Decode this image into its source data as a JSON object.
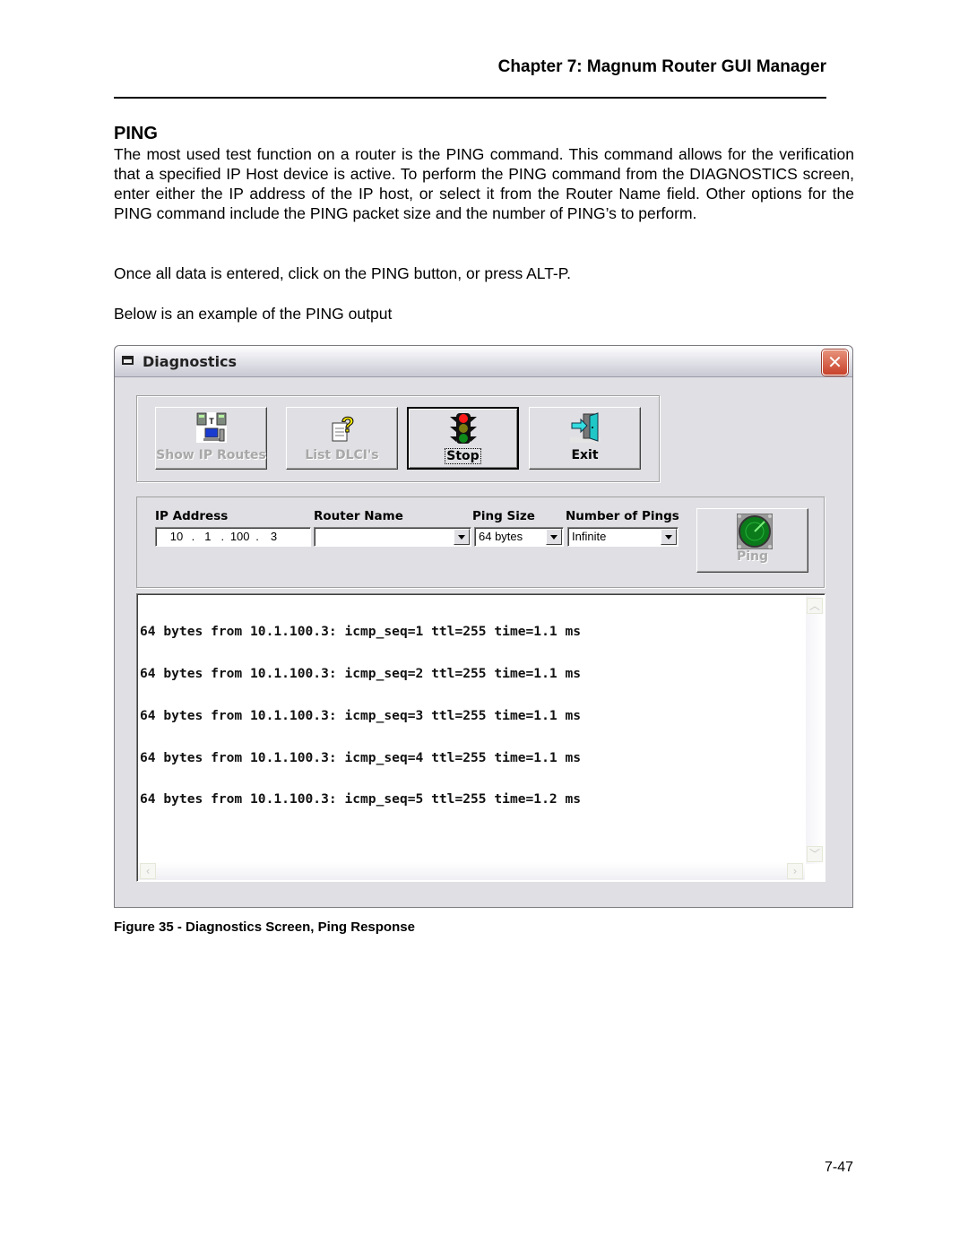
{
  "header": {
    "chapter_title": "Chapter 7: Magnum Router GUI Manager"
  },
  "section": {
    "title": "PING",
    "paragraphs": [
      "The most used test function on a router is the PING command.  This command allows for the verification that a specified IP Host device is active.  To perform the PING command from the DIAGNOSTICS screen, enter either the IP address of the IP host, or select it from the Router Name field.  Other options for the PING command include the PING packet size and the number of PING’s to perform.",
      "Once all data is entered, click on the PING button, or press ALT-P.",
      "Below is an example of the PING output"
    ]
  },
  "window": {
    "title": "Diagnostics",
    "close_glyph": "✕",
    "toolbar": [
      {
        "id": "show-ip-routes",
        "label": "Show IP Routes",
        "icon": "network-computers-icon",
        "enabled": false
      },
      {
        "id": "list-dlcis",
        "label": "List DLCI's",
        "icon": "document-question-icon",
        "enabled": false
      },
      {
        "id": "stop",
        "label": "Stop",
        "icon": "traffic-light-icon",
        "enabled": true,
        "default": true
      },
      {
        "id": "exit",
        "label": "Exit",
        "icon": "exit-door-icon",
        "enabled": true
      }
    ],
    "fields": {
      "ip_address": {
        "label": "IP Address",
        "octets": [
          "10",
          "1",
          "100",
          "3"
        ]
      },
      "router_name": {
        "label": "Router Name",
        "value": ""
      },
      "ping_size": {
        "label": "Ping Size",
        "value": "64 bytes"
      },
      "number_of_pings": {
        "label": "Number of Pings",
        "value": "Infinite"
      }
    },
    "ping_button": {
      "label": "Ping",
      "icon": "radar-icon",
      "enabled": false
    },
    "output_lines": [
      "64 bytes from 10.1.100.3: icmp_seq=1 ttl=255 time=1.1 ms",
      "64 bytes from 10.1.100.3: icmp_seq=2 ttl=255 time=1.1 ms",
      "64 bytes from 10.1.100.3: icmp_seq=3 ttl=255 time=1.1 ms",
      "64 bytes from 10.1.100.3: icmp_seq=4 ttl=255 time=1.1 ms",
      "64 bytes from 10.1.100.3: icmp_seq=5 ttl=255 time=1.2 ms"
    ]
  },
  "figure_caption": "Figure 35 - Diagnostics Screen, Ping Response",
  "page_number": "7-47"
}
